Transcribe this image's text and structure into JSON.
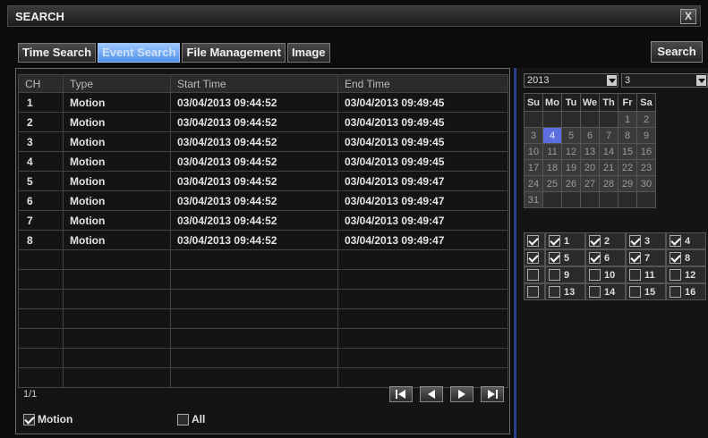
{
  "window": {
    "title": "SEARCH",
    "close_label": "X"
  },
  "tabs": [
    {
      "label": "Time Search",
      "active": false
    },
    {
      "label": "Event Search",
      "active": true
    },
    {
      "label": "File Management",
      "active": false
    },
    {
      "label": "Image",
      "active": false
    }
  ],
  "search_button": "Search",
  "results": {
    "columns": [
      "CH",
      "Type",
      "Start Time",
      "End Time"
    ],
    "rows": [
      [
        "1",
        "Motion",
        "03/04/2013 09:44:52",
        "03/04/2013 09:49:45"
      ],
      [
        "2",
        "Motion",
        "03/04/2013 09:44:52",
        "03/04/2013 09:49:45"
      ],
      [
        "3",
        "Motion",
        "03/04/2013 09:44:52",
        "03/04/2013 09:49:45"
      ],
      [
        "4",
        "Motion",
        "03/04/2013 09:44:52",
        "03/04/2013 09:49:45"
      ],
      [
        "5",
        "Motion",
        "03/04/2013 09:44:52",
        "03/04/2013 09:49:47"
      ],
      [
        "6",
        "Motion",
        "03/04/2013 09:44:52",
        "03/04/2013 09:49:47"
      ],
      [
        "7",
        "Motion",
        "03/04/2013 09:44:52",
        "03/04/2013 09:49:47"
      ],
      [
        "8",
        "Motion",
        "03/04/2013 09:44:52",
        "03/04/2013 09:49:47"
      ]
    ],
    "empty_rows": 7,
    "page": "1/1"
  },
  "pager": {
    "icons": [
      "first-page-icon",
      "prev-page-icon",
      "next-page-icon",
      "last-page-icon"
    ]
  },
  "filters": [
    {
      "label": "Motion",
      "checked": true
    },
    {
      "label": "All",
      "checked": false
    }
  ],
  "calendar": {
    "year": "2013",
    "month": "3",
    "weekdays": [
      "Su",
      "Mo",
      "Tu",
      "We",
      "Th",
      "Fr",
      "Sa"
    ],
    "weeks": [
      [
        "",
        "",
        "",
        "",
        "",
        "1",
        "2"
      ],
      [
        "3",
        "4",
        "5",
        "6",
        "7",
        "8",
        "9"
      ],
      [
        "10",
        "11",
        "12",
        "13",
        "14",
        "15",
        "16"
      ],
      [
        "17",
        "18",
        "19",
        "20",
        "21",
        "22",
        "23"
      ],
      [
        "24",
        "25",
        "26",
        "27",
        "28",
        "29",
        "30"
      ],
      [
        "31",
        "",
        "",
        "",
        "",
        "",
        ""
      ]
    ],
    "selected_day": "4"
  },
  "channels": {
    "all_checked_rows": [
      true,
      true,
      false,
      false
    ],
    "rows": [
      [
        {
          "label": "1",
          "checked": true
        },
        {
          "label": "2",
          "checked": true
        },
        {
          "label": "3",
          "checked": true
        },
        {
          "label": "4",
          "checked": true
        }
      ],
      [
        {
          "label": "5",
          "checked": true
        },
        {
          "label": "6",
          "checked": true
        },
        {
          "label": "7",
          "checked": true
        },
        {
          "label": "8",
          "checked": true
        }
      ],
      [
        {
          "label": "9",
          "checked": false
        },
        {
          "label": "10",
          "checked": false
        },
        {
          "label": "11",
          "checked": false
        },
        {
          "label": "12",
          "checked": false
        }
      ],
      [
        {
          "label": "13",
          "checked": false
        },
        {
          "label": "14",
          "checked": false
        },
        {
          "label": "15",
          "checked": false
        },
        {
          "label": "16",
          "checked": false
        }
      ]
    ]
  },
  "colors": {
    "accent": "#5b6fe0",
    "active_tab": "#6fa8f5",
    "panel_border": "#2b3f8a"
  }
}
